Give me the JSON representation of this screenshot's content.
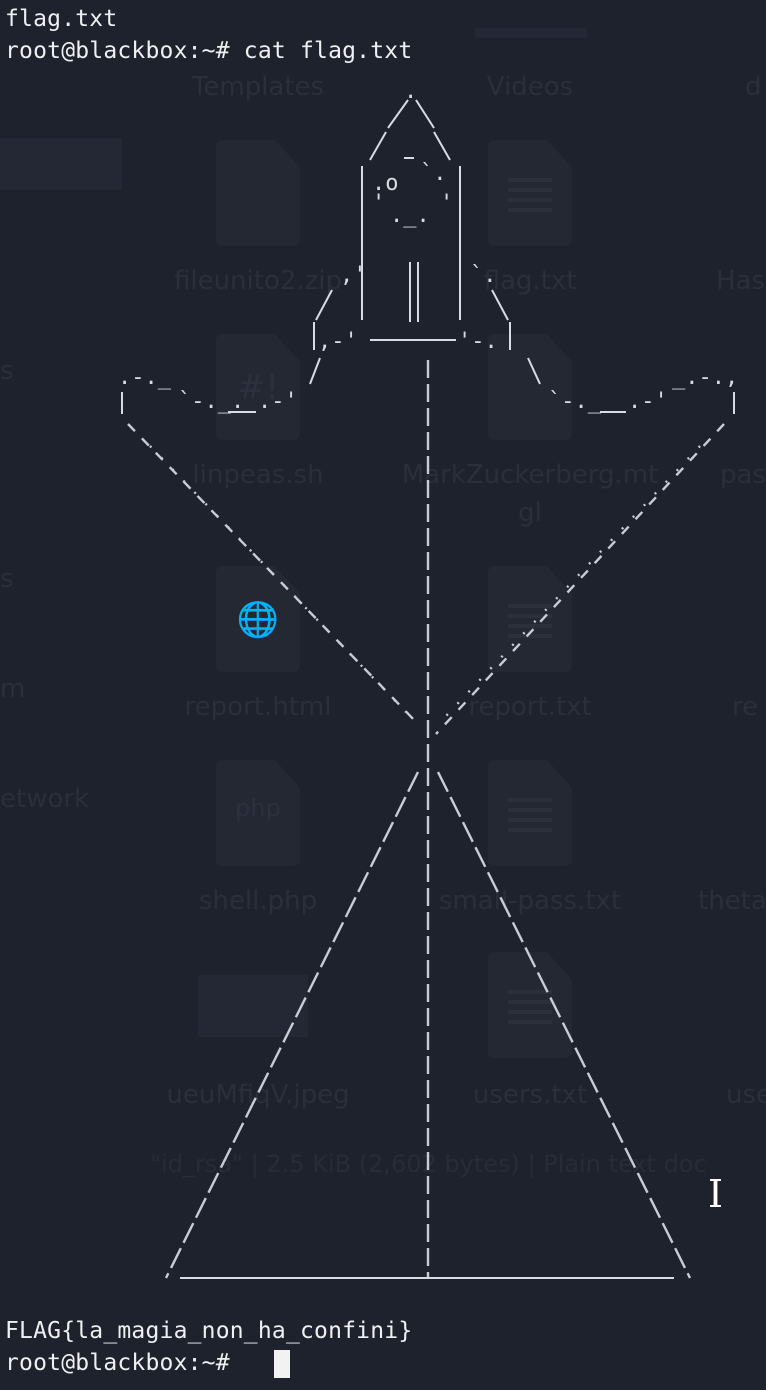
{
  "terminal": {
    "lines": [
      "flag.txt",
      "root@blackbox:~# cat flag.txt",
      "FLAG{la_magia_non_ha_confini}",
      "root@blackbox:~# "
    ]
  },
  "desktop_background": {
    "icon_labels": {
      "templates": "Templates",
      "videos": "Videos",
      "col3_row1": "d",
      "fileunito2": "fileunito2.zip",
      "flag": "flag.txt",
      "col3_row2": "Has",
      "linpeas": "linpeas.sh",
      "markzuckerberg": "MarkZuckerberg.mtgl",
      "col3_row3": "pas",
      "report_html": "report.html",
      "report_txt": "report.txt",
      "col3_row4": "re",
      "shell": "shell.php",
      "small_pass": "small-pass.txt",
      "col3_row5": "theta",
      "ueumfigv": "ueuMfiqV.jpeg",
      "users": "users.txt",
      "col3_row6": "use"
    },
    "sidebar_fragments": {
      "frag1": "s",
      "frag2": "s",
      "frag3": "m",
      "frag4": "etwork"
    },
    "status_text": "\"id_rsa\" | 2.5 KiB (2,602 bytes) | Plain text doc",
    "file_glyphs": {
      "linpeas": "#!",
      "report_html": "🌐",
      "shell": "php"
    },
    "text_color": "#2a2f3b"
  },
  "colors": {
    "background": "#1e222c",
    "terminal_text": "#eef0f4",
    "ascii_art": "#d8dbe2",
    "cursor": "#f2f2f2"
  }
}
